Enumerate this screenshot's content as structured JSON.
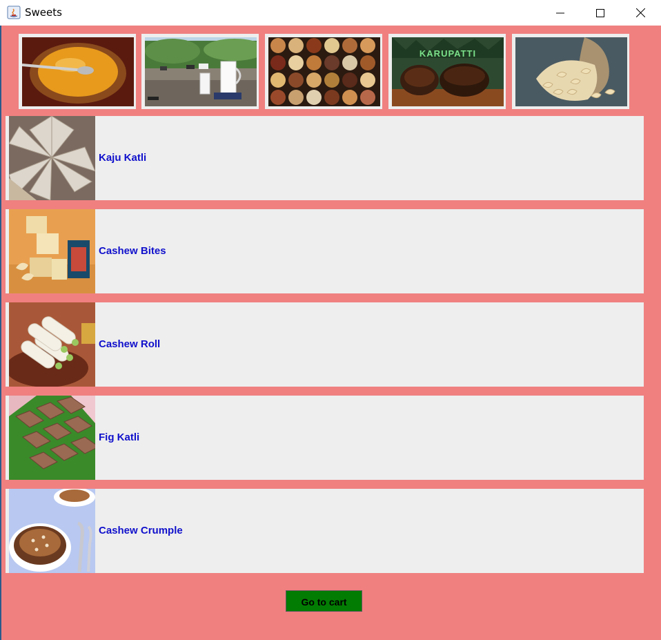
{
  "window": {
    "title": "Sweets"
  },
  "colors": {
    "background": "#f08080",
    "product_name": "#1010cc",
    "cart_button": "#037c03"
  },
  "banners": [
    {
      "name": "halwa-bowl-image"
    },
    {
      "name": "milk-jug-farm-image"
    },
    {
      "name": "dry-fruits-bowls-image"
    },
    {
      "name": "karupatti-jaggery-image",
      "caption": "KARUPATTI"
    },
    {
      "name": "cashew-sack-image"
    }
  ],
  "products": [
    {
      "name": "Kaju Katli"
    },
    {
      "name": "Cashew Bites"
    },
    {
      "name": "Cashew Roll"
    },
    {
      "name": "Fig Katli"
    },
    {
      "name": "Cashew Crumple"
    }
  ],
  "cart_button": {
    "label": "Go to cart"
  }
}
